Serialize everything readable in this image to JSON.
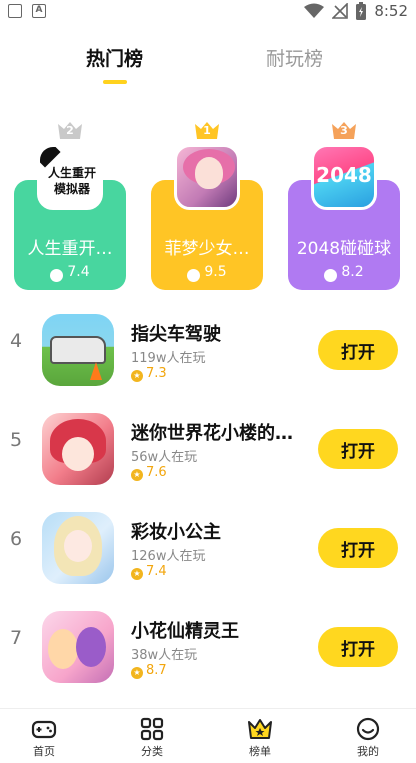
{
  "status_bar": {
    "time": "8:52",
    "left_icons": [
      "notification-icon",
      "a-icon"
    ],
    "right_icons": [
      "wifi-icon",
      "signal-off-icon",
      "battery-icon"
    ]
  },
  "tabs": [
    {
      "label": "热门榜",
      "active": true
    },
    {
      "label": "耐玩榜",
      "active": false
    }
  ],
  "podium": [
    {
      "rank": "2",
      "name": "人生重开…",
      "score": "7.4",
      "icon_text": "人生重开\n模拟器",
      "color": "#48d69f"
    },
    {
      "rank": "1",
      "name": "菲梦少女…",
      "score": "9.5",
      "color": "#ffc525"
    },
    {
      "rank": "3",
      "name": "2048碰碰球",
      "score": "8.2",
      "icon_text": "2048",
      "color": "#b07af2"
    }
  ],
  "list": [
    {
      "rank": "4",
      "name": "指尖车驾驶",
      "players": "119w人在玩",
      "score": "7.3",
      "button": "打开"
    },
    {
      "rank": "5",
      "name": "迷你世界花小楼的…",
      "players": "56w人在玩",
      "score": "7.6",
      "button": "打开"
    },
    {
      "rank": "6",
      "name": "彩妆小公主",
      "players": "126w人在玩",
      "score": "7.4",
      "button": "打开"
    },
    {
      "rank": "7",
      "name": "小花仙精灵王",
      "players": "38w人在玩",
      "score": "8.7",
      "button": "打开"
    }
  ],
  "bottom_nav": [
    {
      "label": "首页",
      "icon": "gamepad-icon"
    },
    {
      "label": "分类",
      "icon": "grid-icon"
    },
    {
      "label": "榜单",
      "icon": "crown-icon",
      "active": true
    },
    {
      "label": "我的",
      "icon": "smile-icon"
    }
  ],
  "colors": {
    "accent": "#ffd71f",
    "green": "#48d69f",
    "gold": "#ffc525",
    "purple": "#b07af2"
  }
}
